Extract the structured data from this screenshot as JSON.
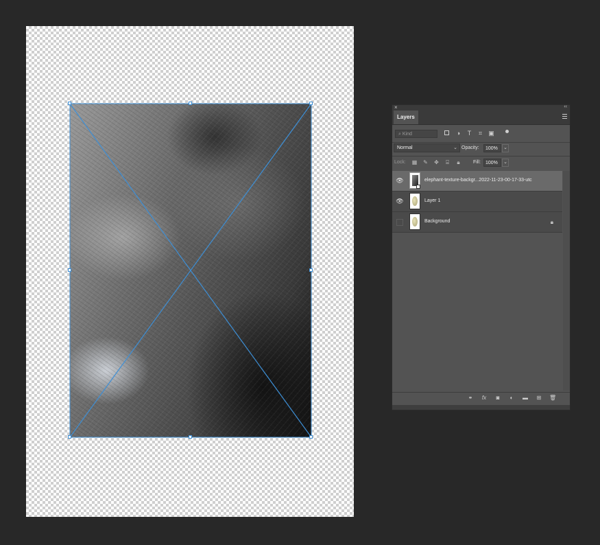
{
  "canvas": {
    "placed_image_name": "elephant texture"
  },
  "layers_panel": {
    "close_glyph": "×",
    "collapse_glyph": "‹‹",
    "tab_label": "Layers",
    "kind_placeholder": "Kind",
    "blend_mode": "Normal",
    "opacity_label": "Opacity:",
    "opacity_value": "100%",
    "lock_label": "Lock:",
    "fill_label": "Fill:",
    "fill_value": "100%",
    "layers": [
      {
        "name": "elephant-texture-backgr...2022-11-23-00-17-33-utc",
        "visible": true,
        "selected": true,
        "type": "smart-object"
      },
      {
        "name": "Layer 1",
        "visible": true,
        "selected": false,
        "type": "pixel"
      },
      {
        "name": "Background",
        "visible": false,
        "selected": false,
        "type": "pixel",
        "locked": true
      }
    ],
    "footer_icons": [
      "link-icon",
      "fx-icon",
      "mask-icon",
      "adjustment-icon",
      "folder-icon",
      "new-layer-icon",
      "trash-icon"
    ]
  },
  "colors": {
    "app_bg": "#282828",
    "panel_bg": "#535353",
    "selection_accent": "#3d8fd6",
    "selected_row": "#6a6a6a"
  }
}
